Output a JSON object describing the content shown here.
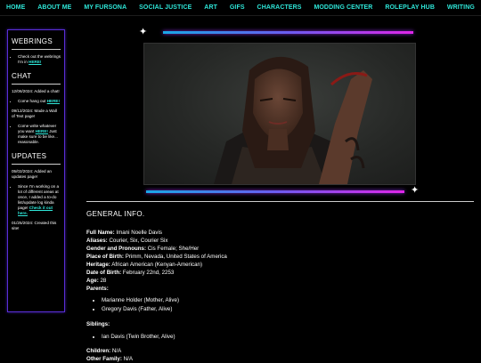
{
  "nav": [
    "HOME",
    "ABOUT ME",
    "MY FURSONA",
    "SOCIAL JUSTICE",
    "ART",
    "GIFS",
    "CHARACTERS",
    "MODDING CENTER",
    "ROLEPLAY HUB",
    "WRITING"
  ],
  "sidebar": {
    "webrings": {
      "title": "WEBRINGS",
      "item_text": "Check out the webrings I'm in",
      "item_link": "HERE!"
    },
    "chat": {
      "title": "CHAT",
      "entry1": "12/06/2024: Added a chat!",
      "item1_text": "Come hang out",
      "item1_link": "HERE!",
      "entry2": "09/12/2024: Made a Wall of Text page!",
      "item2_text": "Come write whatever you want",
      "item2_link": "HERE!",
      "item2_after": "Just make sure to be like... reasonable."
    },
    "updates": {
      "title": "UPDATES",
      "entry1": "05/02/2024: Added an updates page!",
      "item_text": "Since I'm working on a lot of different areas at once, I added a to-do list/update log kinda page!",
      "item_link": "Check it out here.",
      "entry2": "01/25/2024: Created this site!"
    }
  },
  "info": {
    "heading": "GENERAL INFO.",
    "fields": [
      {
        "label": "Full Name:",
        "value": "Imani Noelle Davis"
      },
      {
        "label": "Aliases:",
        "value": "Courier, Six, Courier Six"
      },
      {
        "label": "Gender and Pronouns:",
        "value": "Cis Female; She/Her"
      },
      {
        "label": "Place of Birth:",
        "value": "Primm, Nevada, United States of America"
      },
      {
        "label": "Heritage:",
        "value": "African American (Kenyan-American)"
      },
      {
        "label": "Date of Birth:",
        "value": "February 22nd, 2253"
      },
      {
        "label": "Age:",
        "value": "28"
      },
      {
        "label": "Parents:",
        "value": ""
      }
    ],
    "parents": [
      "Marianne Holder (Mother, Alive)",
      "Gregory Davis (Father, Alive)"
    ],
    "siblings_label": "Siblings:",
    "siblings": [
      "Ian Davis (Twin Brother, Alive)"
    ],
    "children_label": "Children:",
    "children_value": "N/A",
    "other_label": "Other Family:",
    "other_value": "N/A"
  },
  "colors": {
    "accent": "#2ee6d8",
    "sidebar_border": "#5a2ed6",
    "bar_start": "#19a8e6",
    "bar_end": "#e026e8"
  }
}
